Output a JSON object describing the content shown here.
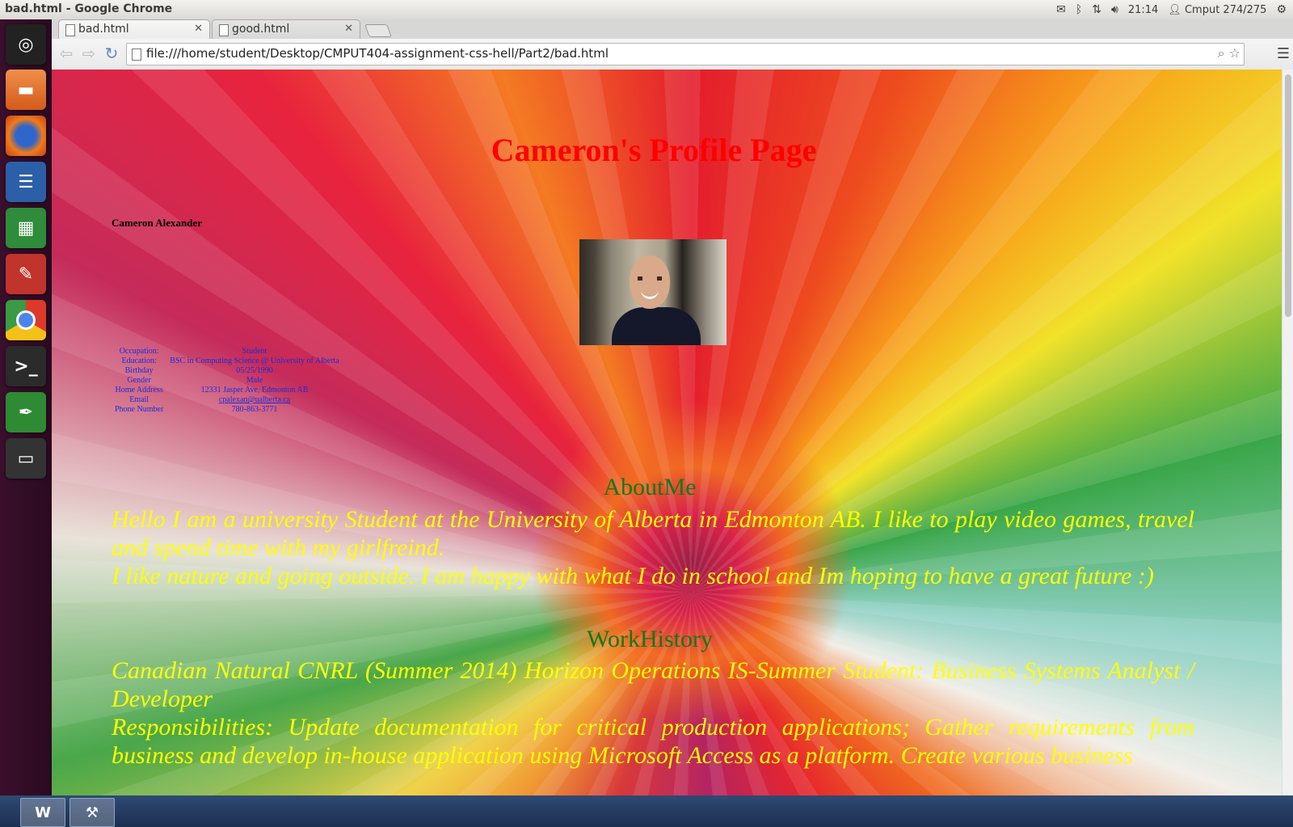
{
  "top_panel": {
    "window_title": "bad.html - Google Chrome",
    "time": "21:14",
    "user": "Cmput 274/275"
  },
  "browser": {
    "tabs": [
      {
        "label": "bad.html"
      },
      {
        "label": "good.html"
      }
    ],
    "url": "file:///home/student/Desktop/CMPUT404-assignment-css-hell/Part2/bad.html"
  },
  "page": {
    "heading": "Cameron's Profile Page",
    "name": "Cameron Alexander",
    "info": [
      {
        "label": "Occupation:",
        "value": "Student"
      },
      {
        "label": "Education:",
        "value": "BSC in Computing Science @ University of Alberta"
      },
      {
        "label": "Birthday",
        "value": "05/25/1990"
      },
      {
        "label": "Gender",
        "value": "Male"
      },
      {
        "label": "Home Address",
        "value": "12331 Jasper Ave, Edmonton AB"
      },
      {
        "label": "Email",
        "value": "cpalexan@ualberta.ca"
      },
      {
        "label": "Phone Number",
        "value": "780-863-3771"
      }
    ],
    "about_heading": "AboutMe",
    "about_text": "Hello I am a university Student at the University of Alberta in Edmonton AB. I like to play video games, travel and spend time with my girlfreind.",
    "about_text_2": "I like nature and going outside. I am happy with what I do in school and Im hoping to have a great future :)",
    "work_heading": "WorkHistory",
    "work_text": "Canadian Natural CNRL (Summer 2014) Horizon Operations IS-Summer Student: Business Systems Analyst / Developer",
    "work_text_2": "Responsibilities: Update documentation for critical production applications; Gather requirements from business and develop in-house application using Microsoft Access as a platform. Create various business"
  },
  "colors": {
    "heading": "#ff0000",
    "section_heading": "#0e7a1a",
    "body_text": "#ffff00",
    "info_text": "#1a2bd8"
  }
}
